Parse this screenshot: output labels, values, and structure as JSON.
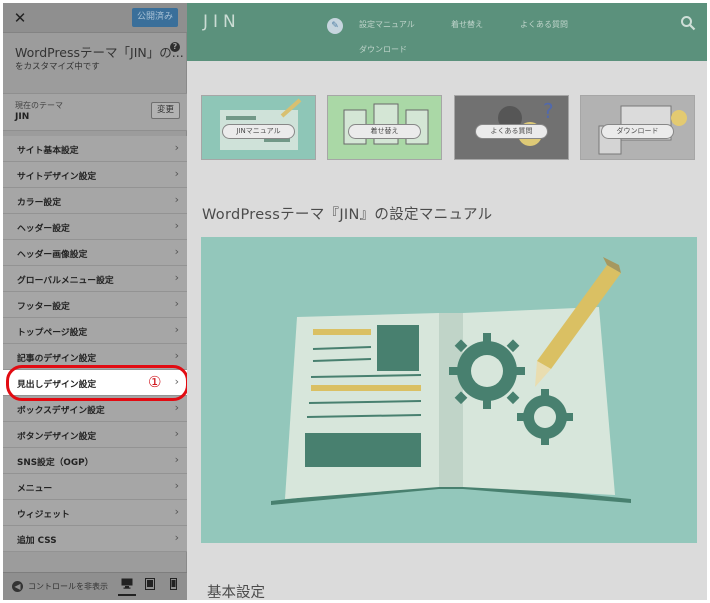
{
  "sidebar": {
    "close_symbol": "✕",
    "publish_label": "公開済み",
    "title": "WordPressテーマ「JIN」の...",
    "subtitle": "をカスタマイズ中です",
    "help_symbol": "?",
    "theme_label": "現在のテーマ",
    "theme_name": "JIN",
    "change_label": "変更",
    "items": [
      {
        "label": "サイト基本設定"
      },
      {
        "label": "サイトデザイン設定"
      },
      {
        "label": "カラー設定"
      },
      {
        "label": "ヘッダー設定"
      },
      {
        "label": "ヘッダー画像設定"
      },
      {
        "label": "グローバルメニュー設定"
      },
      {
        "label": "フッター設定"
      },
      {
        "label": "トップページ設定"
      },
      {
        "label": "記事のデザイン設定"
      },
      {
        "label": "見出しデザイン設定"
      },
      {
        "label": "ボックスデザイン設定"
      },
      {
        "label": "ボタンデザイン設定"
      },
      {
        "label": "SNS設定（OGP）"
      },
      {
        "label": "メニュー"
      },
      {
        "label": "ウィジェット"
      },
      {
        "label": "追加 CSS"
      }
    ],
    "chevron": "›",
    "active_marker": "①",
    "hide_controls_label": "コントロールを非表示",
    "devices": [
      "desktop-icon",
      "tablet-icon",
      "mobile-icon"
    ]
  },
  "preview": {
    "logo": "JIN",
    "nav": [
      "設定マニュアル",
      "着せ替え",
      "よくある質問",
      "ダウンロード"
    ],
    "banners": [
      {
        "label": "JINマニュアル",
        "color": "#7fbfae"
      },
      {
        "label": "着せ替え",
        "color": "#9fd39a"
      },
      {
        "label": "よくある質問",
        "color": "#5e5e5e"
      },
      {
        "label": "ダウンロード",
        "color": "#9a9a9a"
      }
    ],
    "page_title": "WordPressテーマ『JIN』の設定マニュアル",
    "section_title": "基本設定"
  },
  "colors": {
    "header_bg": "#45826a",
    "hero_bg": "#85c0b2",
    "highlight": "#e20b12",
    "publish_bg": "#3a6f9a"
  }
}
